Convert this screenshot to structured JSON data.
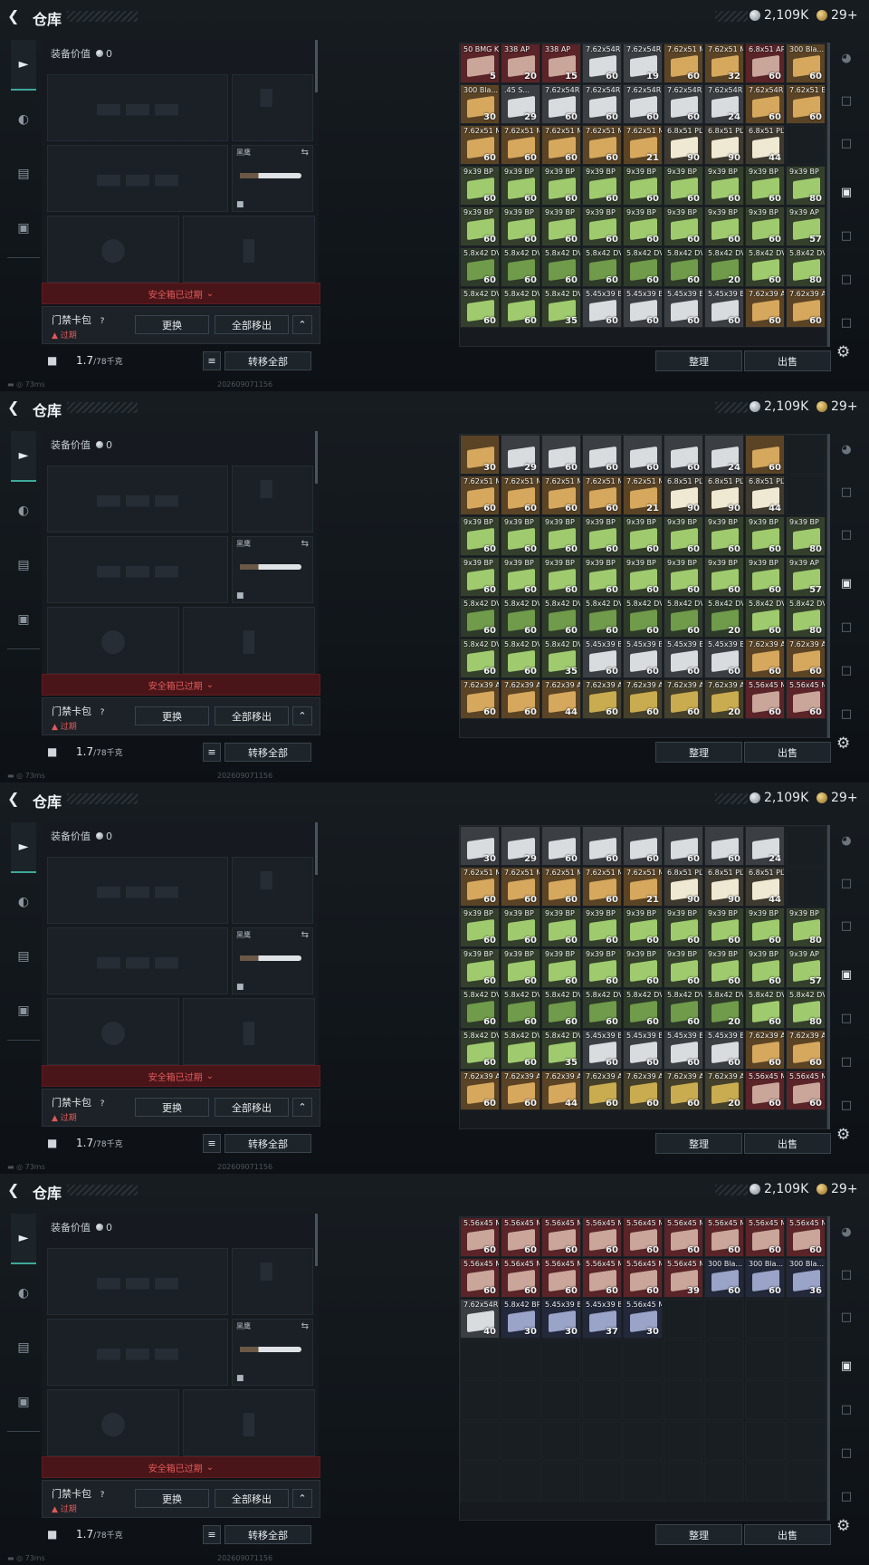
{
  "header": {
    "title": "仓库",
    "silver": "2,109K",
    "gold": "29+"
  },
  "equip": {
    "value_label": "装备价值",
    "value": "0",
    "knife_label": "黑鹰",
    "safe_box_status": "安全箱已过期",
    "card_name": "门禁卡包",
    "card_help": "?",
    "card_expired": "过期",
    "replace_label": "更换",
    "move_all_label": "全部移出",
    "weight": "1.7",
    "weight_max": "/78千克",
    "transfer_all_label": "转移全部"
  },
  "status": {
    "ping": "73ms",
    "timestamp": "202609071156"
  },
  "actions": {
    "sort_label": "整理",
    "sell_label": "出售"
  },
  "colors": {
    "accent": "#3ea89a",
    "danger": "#e05a5a"
  },
  "icons": [
    "back-arrow-icon",
    "pistol-icon",
    "helmet-icon",
    "vest-icon",
    "briefcase-icon",
    "helmet-outline-icon",
    "card-icon",
    "settings-icon"
  ],
  "panels": [
    {
      "cells": [
        [
          "50 BMG K...",
          "5",
          "r"
        ],
        [
          "338 AP",
          "20",
          "r"
        ],
        [
          "338 AP",
          "15",
          "r"
        ],
        [
          "7.62x54R S...",
          "60",
          "w"
        ],
        [
          "7.62x54R S...",
          "19",
          "w"
        ],
        [
          "7.62x51 M...",
          "60",
          "o"
        ],
        [
          "7.62x51 M...",
          "32",
          "o"
        ],
        [
          "6.8x51 AP",
          "60",
          "r"
        ],
        [
          "300 Bla... T...",
          "60",
          "o"
        ],
        [
          "300 Bla... T...",
          "30",
          "o"
        ],
        [
          ".45 S...",
          "29",
          "w"
        ],
        [
          "7.62x54R B...",
          "60",
          "w"
        ],
        [
          "7.62x54R B...",
          "60",
          "w"
        ],
        [
          "7.62x54R B...",
          "60",
          "w"
        ],
        [
          "7.62x54R B...",
          "60",
          "w"
        ],
        [
          "7.62x54R B...",
          "24",
          "w"
        ],
        [
          "7.62x54R B...",
          "60",
          "o"
        ],
        [
          "7.62x51 B...",
          "60",
          "o"
        ],
        [
          "7.62x51 M...",
          "60",
          "o"
        ],
        [
          "7.62x51 M...",
          "60",
          "o"
        ],
        [
          "7.62x51 M...",
          "60",
          "o"
        ],
        [
          "7.62x51 M...",
          "60",
          "o"
        ],
        [
          "7.62x51 M...",
          "21",
          "o"
        ],
        [
          "6.8x51 PLY...",
          "90",
          "b"
        ],
        [
          "6.8x51 PLY...",
          "90",
          "b"
        ],
        [
          "6.8x51 PLY...",
          "44",
          "b"
        ],
        [
          "",
          "",
          " "
        ],
        [
          "9x39 BP",
          "60",
          "g"
        ],
        [
          "9x39 BP",
          "60",
          "g"
        ],
        [
          "9x39 BP",
          "60",
          "g"
        ],
        [
          "9x39 BP",
          "60",
          "g"
        ],
        [
          "9x39 BP",
          "60",
          "g"
        ],
        [
          "9x39 BP",
          "60",
          "g"
        ],
        [
          "9x39 BP",
          "60",
          "g"
        ],
        [
          "9x39 BP",
          "60",
          "g"
        ],
        [
          "9x39 BP",
          "80",
          "g"
        ],
        [
          "9x39 BP",
          "60",
          "g"
        ],
        [
          "9x39 BP",
          "60",
          "g"
        ],
        [
          "9x39 BP",
          "60",
          "g"
        ],
        [
          "9x39 BP",
          "60",
          "g"
        ],
        [
          "9x39 BP",
          "60",
          "g"
        ],
        [
          "9x39 BP",
          "60",
          "g"
        ],
        [
          "9x39 BP",
          "60",
          "g"
        ],
        [
          "9x39 BP",
          "60",
          "g"
        ],
        [
          "9x39 AP",
          "57",
          "g"
        ],
        [
          "5.8x42 DVC12+P",
          "60",
          "d"
        ],
        [
          "5.8x42 DVC12+P",
          "60",
          "d"
        ],
        [
          "5.8x42 DVC12+P",
          "60",
          "d"
        ],
        [
          "5.8x42 DVC12+P",
          "60",
          "d"
        ],
        [
          "5.8x42 DVC12+P",
          "60",
          "d"
        ],
        [
          "5.8x42 DVC12+P",
          "60",
          "d"
        ],
        [
          "5.8x42 DVC12+P",
          "20",
          "d"
        ],
        [
          "5.8x42 DVC12",
          "60",
          "g"
        ],
        [
          "5.8x42 DVC12",
          "80",
          "g"
        ],
        [
          "5.8x42 DVC12",
          "60",
          "g"
        ],
        [
          "5.8x42 DVC12",
          "60",
          "g"
        ],
        [
          "5.8x42 DVC12",
          "35",
          "g"
        ],
        [
          "5.45x39 BP",
          "60",
          "w"
        ],
        [
          "5.45x39 BP",
          "60",
          "w"
        ],
        [
          "5.45x39 BP",
          "60",
          "w"
        ],
        [
          "5.45x39 BP",
          "60",
          "w"
        ],
        [
          "7.62x39 AP",
          "60",
          "o"
        ],
        [
          "7.62x39 AP",
          "60",
          "o"
        ]
      ]
    },
    {
      "cells": [
        [
          "",
          "30",
          "o"
        ],
        [
          "",
          "29",
          "w"
        ],
        [
          "",
          "60",
          "w"
        ],
        [
          "",
          "60",
          "w"
        ],
        [
          "",
          "60",
          "w"
        ],
        [
          "",
          "60",
          "w"
        ],
        [
          "",
          "24",
          "w"
        ],
        [
          "",
          "60",
          "o"
        ],
        [
          "",
          "",
          " "
        ],
        [
          "7.62x51 M...",
          "60",
          "o"
        ],
        [
          "7.62x51 M...",
          "60",
          "o"
        ],
        [
          "7.62x51 M...",
          "60",
          "o"
        ],
        [
          "7.62x51 M...",
          "60",
          "o"
        ],
        [
          "7.62x51 M...",
          "21",
          "o"
        ],
        [
          "6.8x51 PLY...",
          "90",
          "b"
        ],
        [
          "6.8x51 PLY...",
          "90",
          "b"
        ],
        [
          "6.8x51 PLY...",
          "44",
          "b"
        ],
        [
          "",
          "",
          " "
        ],
        [
          "9x39 BP",
          "60",
          "g"
        ],
        [
          "9x39 BP",
          "60",
          "g"
        ],
        [
          "9x39 BP",
          "60",
          "g"
        ],
        [
          "9x39 BP",
          "60",
          "g"
        ],
        [
          "9x39 BP",
          "60",
          "g"
        ],
        [
          "9x39 BP",
          "60",
          "g"
        ],
        [
          "9x39 BP",
          "60",
          "g"
        ],
        [
          "9x39 BP",
          "60",
          "g"
        ],
        [
          "9x39 BP",
          "80",
          "g"
        ],
        [
          "9x39 BP",
          "60",
          "g"
        ],
        [
          "9x39 BP",
          "60",
          "g"
        ],
        [
          "9x39 BP",
          "60",
          "g"
        ],
        [
          "9x39 BP",
          "60",
          "g"
        ],
        [
          "9x39 BP",
          "60",
          "g"
        ],
        [
          "9x39 BP",
          "60",
          "g"
        ],
        [
          "9x39 BP",
          "60",
          "g"
        ],
        [
          "9x39 BP",
          "60",
          "g"
        ],
        [
          "9x39 AP",
          "57",
          "g"
        ],
        [
          "5.8x42 DVC12+P",
          "60",
          "d"
        ],
        [
          "5.8x42 DVC12+P",
          "60",
          "d"
        ],
        [
          "5.8x42 DVC12+P",
          "60",
          "d"
        ],
        [
          "5.8x42 DVC12+P",
          "60",
          "d"
        ],
        [
          "5.8x42 DVC12+P",
          "60",
          "d"
        ],
        [
          "5.8x42 DVC12+P",
          "60",
          "d"
        ],
        [
          "5.8x42 DVC12+P",
          "20",
          "d"
        ],
        [
          "5.8x42 DVC12",
          "60",
          "g"
        ],
        [
          "5.8x42 DVC12",
          "80",
          "g"
        ],
        [
          "5.8x42 DVC12",
          "60",
          "g"
        ],
        [
          "5.8x42 DVC12",
          "60",
          "g"
        ],
        [
          "5.8x42 DVC12",
          "35",
          "g"
        ],
        [
          "5.45x39 BP",
          "60",
          "w"
        ],
        [
          "5.45x39 BP",
          "60",
          "w"
        ],
        [
          "5.45x39 BP",
          "60",
          "w"
        ],
        [
          "5.45x39 BP",
          "60",
          "w"
        ],
        [
          "7.62x39 AP",
          "60",
          "o"
        ],
        [
          "7.62x39 AP",
          "60",
          "o"
        ],
        [
          "7.62x39 AP",
          "60",
          "o"
        ],
        [
          "7.62x39 AP",
          "60",
          "o"
        ],
        [
          "7.62x39 AP",
          "44",
          "o"
        ],
        [
          "7.62x39 AP",
          "60",
          "y"
        ],
        [
          "7.62x39 AP",
          "60",
          "y"
        ],
        [
          "7.62x39 AP",
          "60",
          "y"
        ],
        [
          "7.62x39 AP",
          "20",
          "y"
        ],
        [
          "5.56x45 M...",
          "60",
          "r"
        ],
        [
          "5.56x45 M...",
          "60",
          "r"
        ]
      ]
    },
    {
      "cells": [
        [
          "",
          "30",
          "w"
        ],
        [
          "",
          "29",
          "w"
        ],
        [
          "",
          "60",
          "w"
        ],
        [
          "",
          "60",
          "w"
        ],
        [
          "",
          "60",
          "w"
        ],
        [
          "",
          "60",
          "w"
        ],
        [
          "",
          "60",
          "w"
        ],
        [
          "",
          "24",
          "w"
        ],
        [
          "",
          "",
          " "
        ],
        [
          "7.62x51 M...",
          "60",
          "o"
        ],
        [
          "7.62x51 M...",
          "60",
          "o"
        ],
        [
          "7.62x51 M...",
          "60",
          "o"
        ],
        [
          "7.62x51 M...",
          "60",
          "o"
        ],
        [
          "7.62x51 M...",
          "21",
          "o"
        ],
        [
          "6.8x51 PLY...",
          "90",
          "b"
        ],
        [
          "6.8x51 PLY...",
          "90",
          "b"
        ],
        [
          "6.8x51 PLY...",
          "44",
          "b"
        ],
        [
          "",
          "",
          " "
        ],
        [
          "9x39 BP",
          "60",
          "g"
        ],
        [
          "9x39 BP",
          "60",
          "g"
        ],
        [
          "9x39 BP",
          "60",
          "g"
        ],
        [
          "9x39 BP",
          "60",
          "g"
        ],
        [
          "9x39 BP",
          "60",
          "g"
        ],
        [
          "9x39 BP",
          "60",
          "g"
        ],
        [
          "9x39 BP",
          "60",
          "g"
        ],
        [
          "9x39 BP",
          "60",
          "g"
        ],
        [
          "9x39 BP",
          "80",
          "g"
        ],
        [
          "9x39 BP",
          "60",
          "g"
        ],
        [
          "9x39 BP",
          "60",
          "g"
        ],
        [
          "9x39 BP",
          "60",
          "g"
        ],
        [
          "9x39 BP",
          "60",
          "g"
        ],
        [
          "9x39 BP",
          "60",
          "g"
        ],
        [
          "9x39 BP",
          "60",
          "g"
        ],
        [
          "9x39 BP",
          "60",
          "g"
        ],
        [
          "9x39 BP",
          "60",
          "g"
        ],
        [
          "9x39 AP",
          "57",
          "g"
        ],
        [
          "5.8x42 DVC12+P",
          "60",
          "d"
        ],
        [
          "5.8x42 DVC12+P",
          "60",
          "d"
        ],
        [
          "5.8x42 DVC12+P",
          "60",
          "d"
        ],
        [
          "5.8x42 DVC12+P",
          "60",
          "d"
        ],
        [
          "5.8x42 DVC12+P",
          "60",
          "d"
        ],
        [
          "5.8x42 DVC12+P",
          "60",
          "d"
        ],
        [
          "5.8x42 DVC12+P",
          "20",
          "d"
        ],
        [
          "5.8x42 DVC12",
          "60",
          "g"
        ],
        [
          "5.8x42 DVC12",
          "80",
          "g"
        ],
        [
          "5.8x42 DVC12",
          "60",
          "g"
        ],
        [
          "5.8x42 DVC12",
          "60",
          "g"
        ],
        [
          "5.8x42 DVC12",
          "35",
          "g"
        ],
        [
          "5.45x39 BP",
          "60",
          "w"
        ],
        [
          "5.45x39 BP",
          "60",
          "w"
        ],
        [
          "5.45x39 BP",
          "60",
          "w"
        ],
        [
          "5.45x39 BP",
          "60",
          "w"
        ],
        [
          "7.62x39 AP",
          "60",
          "o"
        ],
        [
          "7.62x39 AP",
          "60",
          "o"
        ],
        [
          "7.62x39 AP",
          "60",
          "o"
        ],
        [
          "7.62x39 AP",
          "60",
          "o"
        ],
        [
          "7.62x39 AP",
          "44",
          "o"
        ],
        [
          "7.62x39 AP",
          "60",
          "y"
        ],
        [
          "7.62x39 AP",
          "60",
          "y"
        ],
        [
          "7.62x39 AP",
          "60",
          "y"
        ],
        [
          "7.62x39 AP",
          "20",
          "y"
        ],
        [
          "5.56x45 M...",
          "60",
          "r"
        ],
        [
          "5.56x45 M...",
          "60",
          "r"
        ]
      ]
    },
    {
      "cells": [
        [
          "5.56x45 M...",
          "60",
          "r"
        ],
        [
          "5.56x45 M...",
          "60",
          "r"
        ],
        [
          "5.56x45 M...",
          "60",
          "r"
        ],
        [
          "5.56x45 M...",
          "60",
          "r"
        ],
        [
          "5.56x45 M...",
          "60",
          "r"
        ],
        [
          "5.56x45 M...",
          "60",
          "r"
        ],
        [
          "5.56x45 M...",
          "60",
          "r"
        ],
        [
          "5.56x45 M...",
          "60",
          "r"
        ],
        [
          "5.56x45 M...",
          "60",
          "r"
        ],
        [
          "5.56x45 M...",
          "60",
          "r"
        ],
        [
          "5.56x45 M...",
          "60",
          "r"
        ],
        [
          "5.56x45 M...",
          "60",
          "r"
        ],
        [
          "5.56x45 M...",
          "60",
          "r"
        ],
        [
          "5.56x45 M...",
          "60",
          "r"
        ],
        [
          "5.56x45 M...",
          "39",
          "r"
        ],
        [
          "300 Bla... BRAS...",
          "60",
          "n"
        ],
        [
          "300 Bla... BRAS...",
          "60",
          "n"
        ],
        [
          "300 Bla... BRAS...",
          "36",
          "n"
        ],
        [
          "7.62x54R SNB",
          "40",
          "w"
        ],
        [
          "5.8x42 BPG",
          "30",
          "n"
        ],
        [
          "5.45x39 BPOOB",
          "30",
          "n"
        ],
        [
          "5.45x39 BPOOB",
          "37",
          "n"
        ],
        [
          "5.56x45 M855A1",
          "30",
          "n"
        ]
      ]
    }
  ]
}
